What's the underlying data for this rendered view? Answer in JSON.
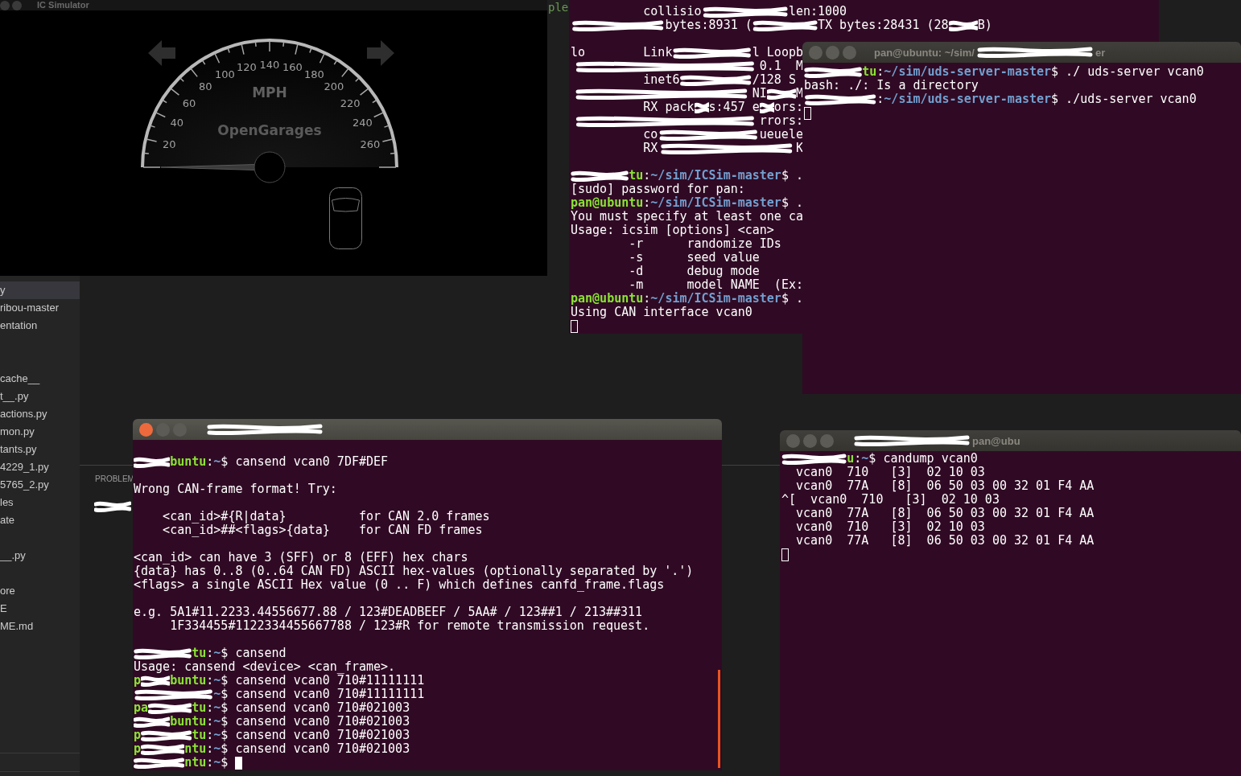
{
  "icsim": {
    "title": "IC Simulator",
    "turn_signals": {
      "left": {
        "on": false
      },
      "right": {
        "on": false
      }
    },
    "speedometer": {
      "labels": [
        "20",
        "40",
        "60",
        "80",
        "100",
        "120",
        "140",
        "160",
        "180",
        "200",
        "220",
        "240",
        "260"
      ],
      "unit": "MPH",
      "brand": "OpenGarages"
    }
  },
  "editor": {
    "text_fragment": "ple",
    "panel_tab": "PROBLEM"
  },
  "explorer": {
    "groups": [
      [
        {
          "label": "y",
          "selected": true
        },
        {
          "label": "ribou-master",
          "selected": false
        },
        {
          "label": "entation",
          "selected": false
        }
      ],
      [
        {
          "label": "cache__",
          "selected": false
        },
        {
          "label": "t__.py",
          "selected": false
        },
        {
          "label": "actions.py",
          "selected": false
        },
        {
          "label": "mon.py",
          "selected": false
        },
        {
          "label": "tants.py",
          "selected": false
        },
        {
          "label": "4229_1.py",
          "selected": false
        },
        {
          "label": "5765_2.py",
          "selected": false
        },
        {
          "label": "les",
          "selected": false
        },
        {
          "label": "ate",
          "selected": false
        }
      ],
      [
        {
          "label": "__.py",
          "selected": false
        }
      ],
      [
        {
          "label": "ore",
          "selected": false
        },
        {
          "label": "E",
          "selected": false
        },
        {
          "label": "ME.md",
          "selected": false
        }
      ]
    ]
  },
  "terminals": [
    {
      "focused": false,
      "blocks": [
        [
          [
            {
              "kind": "plain",
              "text": "          collisio"
            },
            {
              "kind": "redacted"
            },
            {
              "kind": "plain",
              "text": "            len:1000"
            }
          ],
          [
            {
              "kind": "redacted"
            },
            {
              "kind": "plain",
              "text": "             bytes:8931 ("
            },
            {
              "kind": "redacted"
            },
            {
              "kind": "plain",
              "text": "         TX bytes:28431 (28"
            },
            {
              "kind": "redacted"
            },
            {
              "kind": "plain",
              "text": "    B)"
            }
          ]
        ],
        [
          [
            {
              "kind": "plain",
              "text": "lo        Link"
            },
            {
              "kind": "redacted"
            },
            {
              "kind": "plain",
              "text": "           l Loopb"
            }
          ],
          [
            {
              "kind": "redacted"
            },
            {
              "kind": "plain",
              "text": "                          0.1  M"
            }
          ],
          [
            {
              "kind": "plain",
              "text": "          inet6"
            },
            {
              "kind": "redacted"
            },
            {
              "kind": "plain",
              "text": "          /128 S"
            }
          ],
          [
            {
              "kind": "redacted"
            },
            {
              "kind": "plain",
              "text": "                         NI"
            },
            {
              "kind": "redacted"
            },
            {
              "kind": "plain",
              "text": "    M"
            }
          ],
          [
            {
              "kind": "plain",
              "text": "          RX pack"
            },
            {
              "kind": "redacted"
            },
            {
              "kind": "plain",
              "text": "  s:457 e"
            },
            {
              "kind": "redacted"
            },
            {
              "kind": "plain",
              "text": "  ors:"
            }
          ],
          [
            {
              "kind": "redacted"
            },
            {
              "kind": "plain",
              "text": "                          rrors:"
            }
          ],
          [
            {
              "kind": "plain",
              "text": "          co"
            },
            {
              "kind": "redacted"
            },
            {
              "kind": "plain",
              "text": "              ueuele"
            }
          ],
          [
            {
              "kind": "plain",
              "text": "          RX"
            },
            {
              "kind": "redacted"
            },
            {
              "kind": "plain",
              "text": "                   K"
            }
          ]
        ],
        [
          [
            {
              "kind": "redacted"
            },
            {
              "kind": "user",
              "text": "tu"
            },
            {
              "kind": "plain",
              "text": ":"
            },
            {
              "kind": "path",
              "text": "~/sim/ICSim-master"
            },
            {
              "kind": "plain",
              "text": "$ ."
            }
          ],
          "[sudo] password for pan:",
          [
            {
              "kind": "user",
              "text": "pan@ubuntu"
            },
            {
              "kind": "plain",
              "text": ":"
            },
            {
              "kind": "path",
              "text": "~/sim/ICSim-master"
            },
            {
              "kind": "plain",
              "text": "$ ."
            }
          ],
          "You must specify at least one ca",
          "Usage: icsim [options] <can>",
          "        -r      randomize IDs",
          "        -s      seed value",
          "        -d      debug mode",
          "        -m      model NAME  (Ex:",
          [
            {
              "kind": "user",
              "text": "pan@ubuntu"
            },
            {
              "kind": "plain",
              "text": ":"
            },
            {
              "kind": "path",
              "text": "~/sim/ICSim-master"
            },
            {
              "kind": "plain",
              "text": "$ ."
            }
          ],
          "Using CAN interface vcan0",
          [
            {
              "kind": "cursor"
            }
          ]
        ]
      ]
    },
    {
      "focused": false,
      "title": [
        {
          "kind": "plain",
          "text": "pan@ubuntu: ~/sim/"
        },
        {
          "kind": "redacted"
        },
        {
          "kind": "plain",
          "text": "er"
        }
      ],
      "blocks": [
        [
          [
            {
              "kind": "redacted"
            },
            {
              "kind": "user",
              "text": "tu"
            },
            {
              "kind": "plain",
              "text": ":"
            },
            {
              "kind": "path",
              "text": "~/sim/uds-server-master"
            },
            {
              "kind": "plain",
              "text": "$ ./ uds-server vcan0"
            }
          ],
          "bash: ./: Is a directory",
          [
            {
              "kind": "redacted"
            },
            {
              "kind": "plain",
              "text": ":"
            },
            {
              "kind": "path",
              "text": "~/sim/uds-server-master"
            },
            {
              "kind": "plain",
              "text": "$ ./uds-server vcan0"
            }
          ],
          [
            {
              "kind": "cursor"
            }
          ]
        ]
      ]
    },
    {
      "focused": true,
      "title": [
        {
          "kind": "redacted"
        }
      ],
      "blocks": [
        [
          [
            {
              "kind": "redacted"
            },
            {
              "kind": "user",
              "text": "buntu"
            },
            {
              "kind": "plain",
              "text": ":"
            },
            {
              "kind": "path",
              "text": "~"
            },
            {
              "kind": "plain",
              "text": "$ cansend vcan0 7DF#DEF"
            }
          ]
        ],
        [
          "Wrong CAN-frame format! Try:"
        ],
        [
          "    <can_id>#{R|data}          for CAN 2.0 frames",
          "    <can_id>##<flags>{data}    for CAN FD frames"
        ],
        [
          "<can_id> can have 3 (SFF) or 8 (EFF) hex chars",
          "{data} has 0..8 (0..64 CAN FD) ASCII hex-values (optionally separated by '.')",
          "<flags> a single ASCII Hex value (0 .. F) which defines canfd_frame.flags"
        ],
        [
          "e.g. 5A1#11.2233.44556677.88 / 123#DEADBEEF / 5AA# / 123##1 / 213##311",
          "     1F334455#1122334455667788 / 123#R for remote transmission request."
        ],
        [
          [
            {
              "kind": "redacted"
            },
            {
              "kind": "user",
              "text": "tu"
            },
            {
              "kind": "plain",
              "text": ":"
            },
            {
              "kind": "path",
              "text": "~"
            },
            {
              "kind": "plain",
              "text": "$ cansend"
            }
          ],
          "Usage: cansend <device> <can_frame>.",
          [
            {
              "kind": "user",
              "text": "p"
            },
            {
              "kind": "redacted"
            },
            {
              "kind": "user",
              "text": "buntu"
            },
            {
              "kind": "plain",
              "text": ":"
            },
            {
              "kind": "path",
              "text": "~"
            },
            {
              "kind": "plain",
              "text": "$ cansend vcan0 710#11111111"
            }
          ],
          [
            {
              "kind": "redacted"
            },
            {
              "kind": "path",
              "text": "~"
            },
            {
              "kind": "plain",
              "text": "$ cansend vcan0 710#11111111"
            }
          ],
          [
            {
              "kind": "user",
              "text": "pa"
            },
            {
              "kind": "redacted"
            },
            {
              "kind": "user",
              "text": "tu"
            },
            {
              "kind": "plain",
              "text": ":"
            },
            {
              "kind": "path",
              "text": "~"
            },
            {
              "kind": "plain",
              "text": "$ cansend vcan0 710#021003"
            }
          ],
          [
            {
              "kind": "redacted"
            },
            {
              "kind": "user",
              "text": "buntu"
            },
            {
              "kind": "plain",
              "text": ":"
            },
            {
              "kind": "path",
              "text": "~"
            },
            {
              "kind": "plain",
              "text": "$ cansend vcan0 710#021003"
            }
          ],
          [
            {
              "kind": "user",
              "text": "p"
            },
            {
              "kind": "redacted"
            },
            {
              "kind": "user",
              "text": "tu"
            },
            {
              "kind": "plain",
              "text": ":"
            },
            {
              "kind": "path",
              "text": "~"
            },
            {
              "kind": "plain",
              "text": "$ cansend vcan0 710#021003"
            }
          ],
          [
            {
              "kind": "user",
              "text": "p"
            },
            {
              "kind": "redacted"
            },
            {
              "kind": "user",
              "text": "ntu"
            },
            {
              "kind": "plain",
              "text": ":"
            },
            {
              "kind": "path",
              "text": "~"
            },
            {
              "kind": "plain",
              "text": "$ cansend vcan0 710#021003"
            }
          ],
          [
            {
              "kind": "redacted"
            },
            {
              "kind": "user",
              "text": "ntu"
            },
            {
              "kind": "plain",
              "text": ":"
            },
            {
              "kind": "path",
              "text": "~"
            },
            {
              "kind": "plain",
              "text": "$"
            },
            {
              "kind": "cursor"
            }
          ]
        ]
      ]
    },
    {
      "focused": false,
      "title": [
        {
          "kind": "redacted"
        },
        {
          "kind": "plain",
          "text": "pan@ubu"
        }
      ],
      "blocks": [
        [
          [
            {
              "kind": "redacted"
            },
            {
              "kind": "user",
              "text": "u"
            },
            {
              "kind": "plain",
              "text": ":"
            },
            {
              "kind": "path",
              "text": "~"
            },
            {
              "kind": "plain",
              "text": "$ candump vcan0"
            }
          ],
          "  vcan0  710   [3]  02 10 03",
          "  vcan0  77A   [8]  06 50 03 00 32 01 F4 AA",
          "^[  vcan0  710   [3]  02 10 03",
          "  vcan0  77A   [8]  06 50 03 00 32 01 F4 AA",
          "  vcan0  710   [3]  02 10 03",
          "  vcan0  77A   [8]  06 50 03 00 32 01 F4 AA",
          [
            {
              "kind": "cursor"
            }
          ]
        ]
      ]
    }
  ]
}
